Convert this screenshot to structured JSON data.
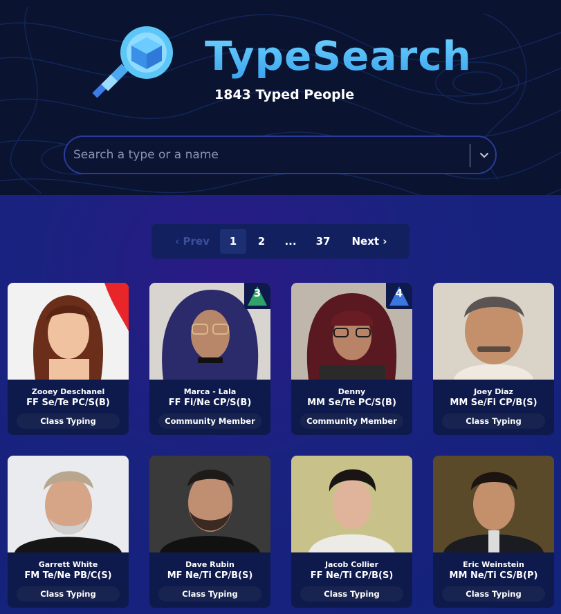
{
  "brand": {
    "title": "TypeSearch",
    "subtitle": "1843 Typed People"
  },
  "search": {
    "placeholder": "Search a type or a name"
  },
  "pagination": {
    "prev": "‹ Prev",
    "pages": [
      "1",
      "2",
      "...",
      "37"
    ],
    "current": "1",
    "next": "Next ›"
  },
  "colors": {
    "accent": "#4fb8f5",
    "header_bg": "#0a1330",
    "card_bg": "#0e1a4c"
  },
  "cards": [
    {
      "name": "Zooey Deschanel",
      "type": "FF Se/Te PC/S(B)",
      "tag": "Class Typing"
    },
    {
      "name": "Marca - Lala",
      "type": "FF Fi/Ne CP/S(B)",
      "tag": "Community Member",
      "badge": "3"
    },
    {
      "name": "Denny",
      "type": "MM Se/Te PC/S(B)",
      "tag": "Community Member",
      "badge": "4"
    },
    {
      "name": "Joey Diaz",
      "type": "MM Se/Fi CP/B(S)",
      "tag": "Class Typing"
    },
    {
      "name": "Garrett White",
      "type": "FM Te/Ne PB/C(S)",
      "tag": "Class Typing"
    },
    {
      "name": "Dave Rubin",
      "type": "MF Ne/Ti CP/B(S)",
      "tag": "Class Typing"
    },
    {
      "name": "Jacob Collier",
      "type": "FF Ne/Ti CP/B(S)",
      "tag": "Class Typing"
    },
    {
      "name": "Eric Weinstein",
      "type": "MM Ne/Ti CS/B(P)",
      "tag": "Class Typing"
    }
  ]
}
